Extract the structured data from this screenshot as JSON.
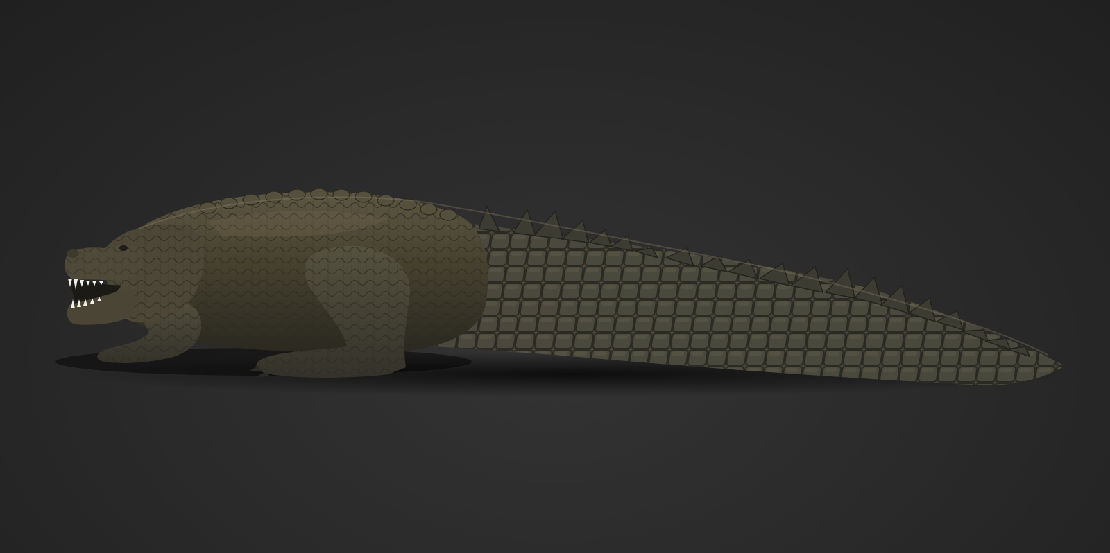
{
  "scene": {
    "background_color": "#2a2a2a",
    "subject": "crocodile-3d-render",
    "skin_color": "#4a4636",
    "scute_color": "#3b3a30",
    "highlight_color": "#6e6450",
    "teeth_color": "#f2f0e8"
  }
}
